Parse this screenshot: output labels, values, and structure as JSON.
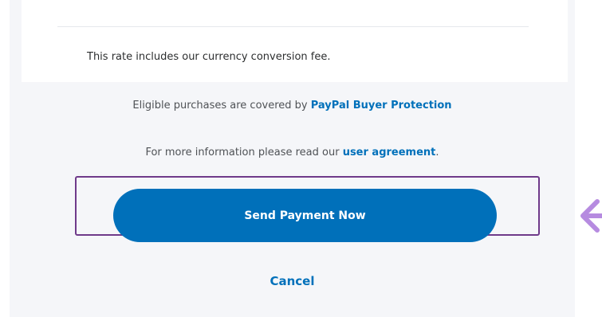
{
  "summary": {
    "rate_note": "This rate includes our currency conversion fee."
  },
  "protection": {
    "prefix": "Eligible purchases are covered by ",
    "link": "PayPal Buyer Protection"
  },
  "agreement": {
    "prefix": "For more information please read our ",
    "link": "user agreement",
    "suffix": "."
  },
  "actions": {
    "send_label": "Send Payment Now",
    "cancel_label": "Cancel"
  },
  "colors": {
    "accent": "#0070ba",
    "highlight": "#6f3a8a",
    "arrow": "#b68be0"
  },
  "icons": {
    "pointer": "arrow-left-icon"
  }
}
